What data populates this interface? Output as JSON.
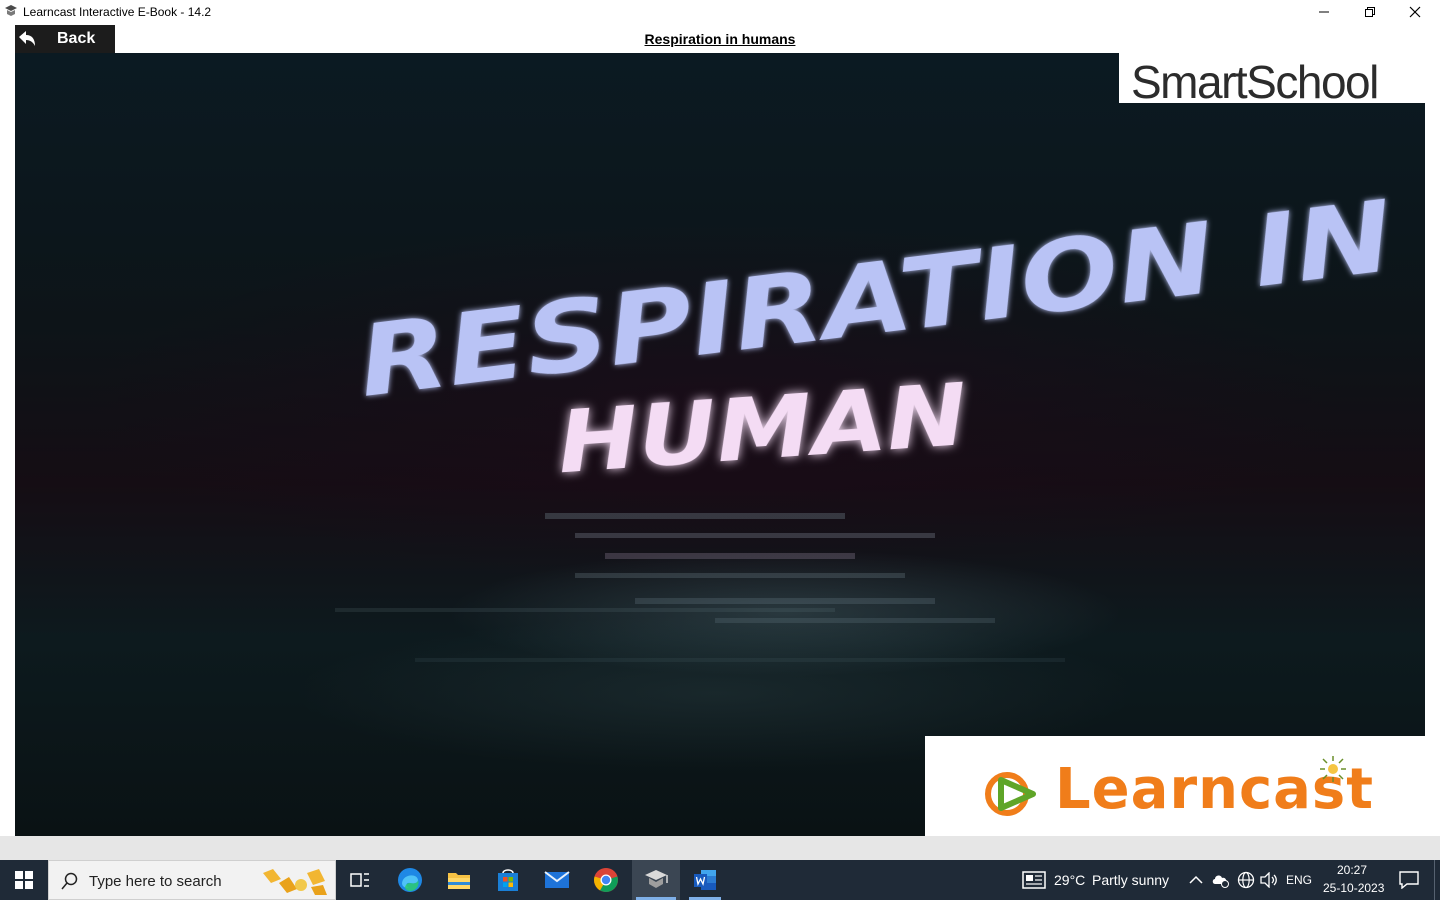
{
  "window": {
    "title": "Learncast Interactive E-Book - 14.2",
    "app_icon": "learncast-app-icon",
    "controls": [
      "minimize-icon",
      "restore-icon",
      "close-icon"
    ]
  },
  "toolbar": {
    "back_label": "Back",
    "back_icon": "back-arrow-icon",
    "page_title": "Respiration in humans"
  },
  "video": {
    "title_line1": "RESPIRATION IN",
    "title_line2": "HUMAN",
    "watermark_top": "SmartSchool",
    "watermark_bottom": "Learncast"
  },
  "taskbar": {
    "search_placeholder": "Type here to search",
    "apps": [
      "start-icon",
      "task-view-icon",
      "edge-icon",
      "file-explorer-icon",
      "store-icon",
      "mail-icon",
      "chrome-icon",
      "learncast-icon",
      "word-icon"
    ],
    "weather_temp": "29°C",
    "weather_text": "Partly sunny",
    "language": "ENG",
    "time": "20:27",
    "date": "25-10-2023"
  },
  "colors": {
    "taskbar_bg": "#1f2a37",
    "learncast_orange": "#f07d1a",
    "learncast_green": "#5fa528",
    "back_button_bg": "#1c1c1c"
  }
}
